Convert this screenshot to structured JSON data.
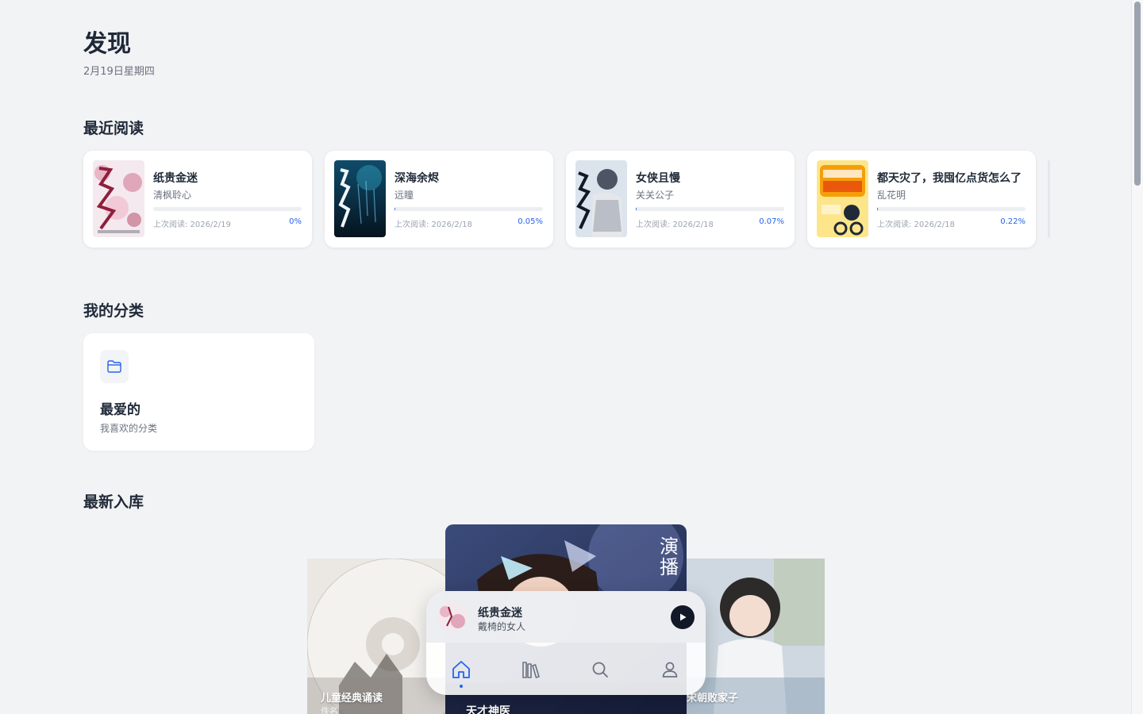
{
  "header": {
    "title": "发现",
    "date": "2月19日星期四"
  },
  "sections": {
    "recent": "最近阅读",
    "categories": "我的分类",
    "newest": "最新入库"
  },
  "recent": [
    {
      "title": "纸贵金迷",
      "author": "清枫聆心",
      "last_read_label": "上次阅读: 2026/2/19",
      "progress_label": "0%",
      "progress": 0.0
    },
    {
      "title": "深海余烬",
      "author": "远瞳",
      "last_read_label": "上次阅读: 2026/2/18",
      "progress_label": "0.05%",
      "progress": 0.0005
    },
    {
      "title": "女侠且慢",
      "author": "关关公子",
      "last_read_label": "上次阅读: 2026/2/18",
      "progress_label": "0.07%",
      "progress": 0.0007
    },
    {
      "title": "都天灾了，我囤亿点货怎么了",
      "author": "乱花明",
      "last_read_label": "上次阅读: 2026/2/18",
      "progress_label": "0.22%",
      "progress": 0.0022
    }
  ],
  "categories": [
    {
      "name": "最爱的",
      "description": "我喜欢的分类",
      "icon": "folder-icon"
    }
  ],
  "newest": [
    {
      "caption": "儿童经典诵读",
      "sub": "佚名"
    },
    {
      "caption": "天才神医",
      "sub": ""
    },
    {
      "caption": "宋朝败家子",
      "sub": ""
    }
  ],
  "player": {
    "title": "纸贵金迷",
    "subtitle": "戴椅的女人",
    "play_icon": "play-icon"
  },
  "bottom_nav": [
    {
      "name": "home-icon",
      "active": true
    },
    {
      "name": "library-icon",
      "active": false
    },
    {
      "name": "search-icon",
      "active": false
    },
    {
      "name": "profile-icon",
      "active": false
    }
  ],
  "colors": {
    "accent": "#2563eb",
    "background": "#f2f3f5",
    "card": "#ffffff",
    "text": "#1f2937",
    "muted": "#6b7280"
  }
}
